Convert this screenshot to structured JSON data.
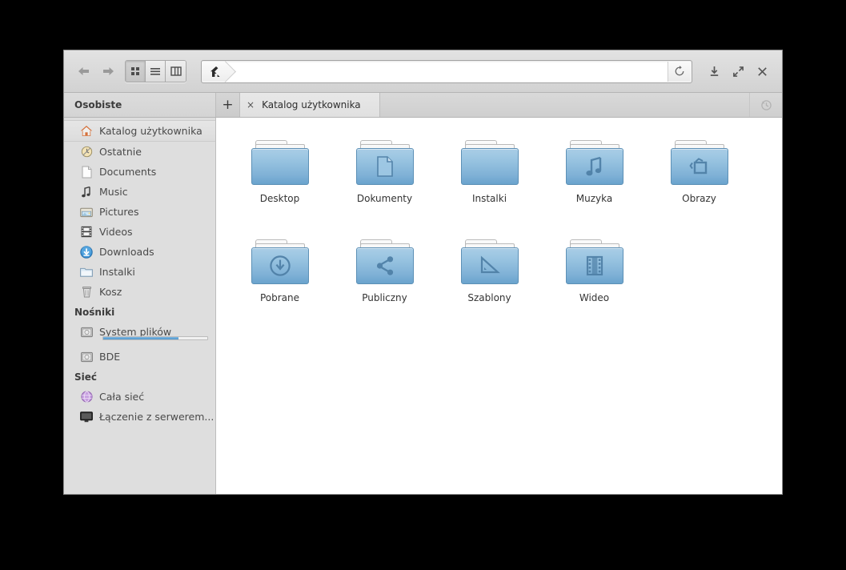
{
  "window": {
    "toolbar": {
      "back_label": "Wstecz",
      "forward_label": "Naprzód",
      "view_icon_grid": "grid-view-icon",
      "view_icon_list": "list-view-icon",
      "view_icon_compact": "compact-view-icon",
      "path_home_label": "Katalog użytkownika",
      "path_value": "",
      "reload_label": "Odśwież",
      "download_label": "Pobieranie",
      "maximize_label": "Maksymalizuj",
      "close_label": "Zamknij"
    },
    "tabbar": {
      "new_tab_label": "+",
      "tab_close_label": "×",
      "tabs": [
        {
          "label": "Katalog użytkownika",
          "active": true
        }
      ],
      "history_label": "Historia"
    }
  },
  "sidebar": {
    "groups": [
      {
        "title": "Osobiste",
        "items": [
          {
            "label": "Katalog użytkownika",
            "icon": "home-icon",
            "selected": true
          },
          {
            "label": "Ostatnie",
            "icon": "recent-clock-icon",
            "selected": false
          },
          {
            "label": "Documents",
            "icon": "document-icon",
            "selected": false
          },
          {
            "label": "Music",
            "icon": "music-note-icon",
            "selected": false
          },
          {
            "label": "Pictures",
            "icon": "pictures-icon",
            "selected": false
          },
          {
            "label": "Videos",
            "icon": "film-strip-icon",
            "selected": false
          },
          {
            "label": "Downloads",
            "icon": "download-circle-icon",
            "selected": false
          },
          {
            "label": "Instalki",
            "icon": "folder-icon",
            "selected": false
          },
          {
            "label": "Kosz",
            "icon": "trash-icon",
            "selected": false
          }
        ]
      },
      {
        "title": "Nośniki",
        "items": [
          {
            "label": "System plików",
            "icon": "drive-icon",
            "selected": false,
            "capacity_percent": 72
          },
          {
            "label": "BDE",
            "icon": "drive-icon",
            "selected": false
          }
        ]
      },
      {
        "title": "Sieć",
        "items": [
          {
            "label": "Cała sieć",
            "icon": "network-globe-icon",
            "selected": false
          },
          {
            "label": "Łączenie z serwerem...",
            "icon": "monitor-icon",
            "selected": false
          }
        ]
      }
    ]
  },
  "content": {
    "files": [
      {
        "label": "Desktop",
        "emblem": "none"
      },
      {
        "label": "Dokumenty",
        "emblem": "document-icon"
      },
      {
        "label": "Instalki",
        "emblem": "none"
      },
      {
        "label": "Muzyka",
        "emblem": "music-note-icon"
      },
      {
        "label": "Obrazy",
        "emblem": "pictures-icon"
      },
      {
        "label": "Pobrane",
        "emblem": "download-circle-icon"
      },
      {
        "label": "Publiczny",
        "emblem": "share-icon"
      },
      {
        "label": "Szablony",
        "emblem": "ruler-triangle-icon"
      },
      {
        "label": "Wideo",
        "emblem": "film-strip-icon"
      }
    ]
  },
  "colors": {
    "folder_blue_light": "#a9cde6",
    "folder_blue_dark": "#6aa3cd",
    "sidebar_bg": "#dedede",
    "capacity_blue": "#4e95cd"
  }
}
